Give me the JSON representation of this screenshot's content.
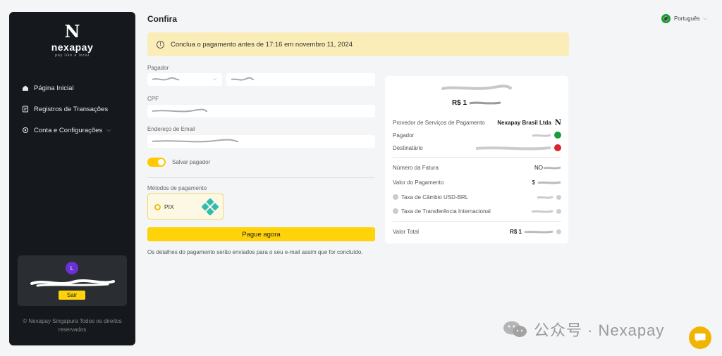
{
  "sidebar": {
    "logo_mark": "N",
    "logo_name": "nexapay",
    "logo_tagline": "pay like a local",
    "items": [
      {
        "label": "Página Inicial"
      },
      {
        "label": "Registros de Transações"
      },
      {
        "label": "Conta e Configurações"
      }
    ],
    "user_initial": "L",
    "logout_label": "Sair",
    "copyright": "© Nexapay Singapura Todos os direitos reservados"
  },
  "header": {
    "title": "Confira",
    "language": "Português"
  },
  "alert": {
    "text": "Conclua o pagamento antes de 17:16 em novembro 11, 2024"
  },
  "form": {
    "payer_label": "Pagador",
    "cpf_label": "CPF",
    "email_label": "Endereço de Email",
    "save_payer_label": "Salvar pagador",
    "save_payer_on": true,
    "methods_label": "Métodos de pagamento",
    "method_pix": "PIX",
    "pay_button": "Pague agora",
    "footnote": "Os detalhes do pagamento serão enviados para o seu e-mail assim que for concluído."
  },
  "summary": {
    "amount_prefix": "R$ 1",
    "provider_label": "Provedor de Serviços de Pagamento",
    "provider_value": "Nexapay Brasil Ltda",
    "payer_label": "Pagador",
    "recipient_label": "Destinatário",
    "invoice_label": "Número da Fatura",
    "invoice_prefix": "NO",
    "payment_value_label": "Valor do Pagamento",
    "payment_value_prefix": "$",
    "fx_label": "Taxa de Câmbio USD-BRL",
    "transfer_fee_label": "Taxa de Transferência Internacional",
    "total_label": "Valor Total",
    "total_prefix": "R$ 1"
  },
  "watermark": {
    "text": "公众号 · Nexapay"
  },
  "colors": {
    "accent": "#ffd20a",
    "sidebar_bg": "#15181c",
    "alert_bg": "#fbedb7"
  }
}
